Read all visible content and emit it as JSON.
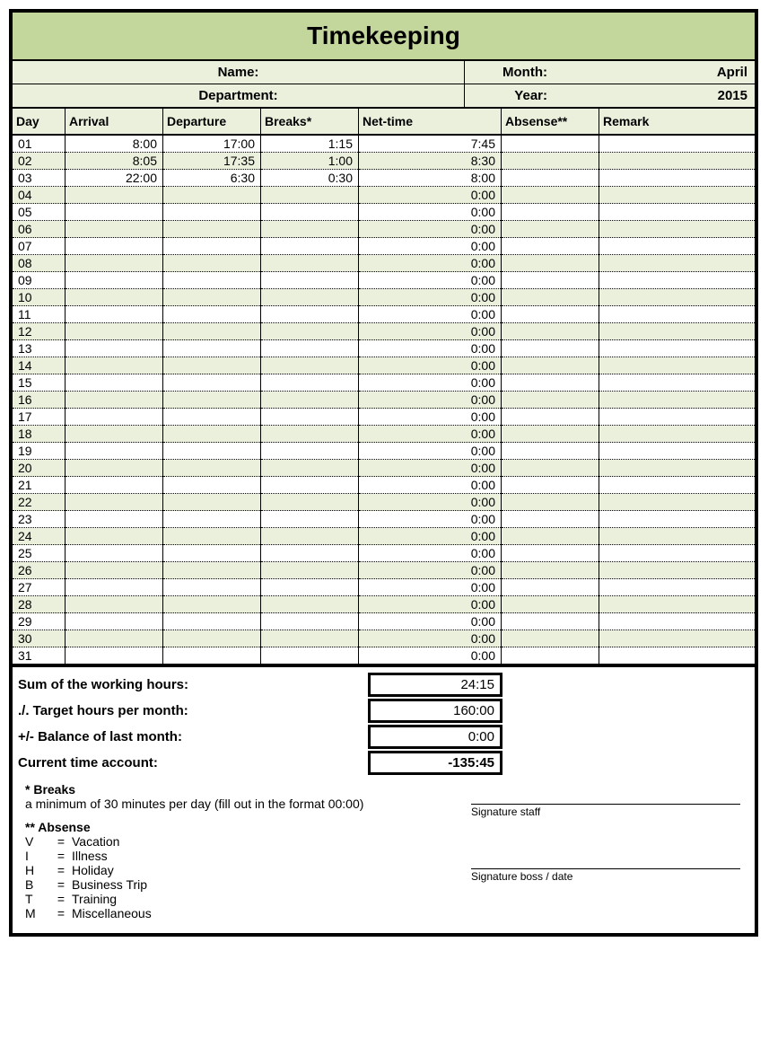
{
  "title": "Timekeeping",
  "labels": {
    "name": "Name:",
    "department": "Department:",
    "month": "Month:",
    "year": "Year:"
  },
  "values": {
    "month": "April",
    "year": "2015"
  },
  "columns": {
    "day": "Day",
    "arrival": "Arrival",
    "departure": "Departure",
    "breaks": "Breaks*",
    "nettime": "Net-time",
    "absense": "Absense**",
    "remark": "Remark"
  },
  "rows": [
    {
      "day": "01",
      "arr": "8:00",
      "dep": "17:00",
      "brk": "1:15",
      "net": "7:45",
      "abs": "",
      "rem": ""
    },
    {
      "day": "02",
      "arr": "8:05",
      "dep": "17:35",
      "brk": "1:00",
      "net": "8:30",
      "abs": "",
      "rem": ""
    },
    {
      "day": "03",
      "arr": "22:00",
      "dep": "6:30",
      "brk": "0:30",
      "net": "8:00",
      "abs": "",
      "rem": ""
    },
    {
      "day": "04",
      "arr": "",
      "dep": "",
      "brk": "",
      "net": "0:00",
      "abs": "",
      "rem": ""
    },
    {
      "day": "05",
      "arr": "",
      "dep": "",
      "brk": "",
      "net": "0:00",
      "abs": "",
      "rem": ""
    },
    {
      "day": "06",
      "arr": "",
      "dep": "",
      "brk": "",
      "net": "0:00",
      "abs": "",
      "rem": ""
    },
    {
      "day": "07",
      "arr": "",
      "dep": "",
      "brk": "",
      "net": "0:00",
      "abs": "",
      "rem": ""
    },
    {
      "day": "08",
      "arr": "",
      "dep": "",
      "brk": "",
      "net": "0:00",
      "abs": "",
      "rem": ""
    },
    {
      "day": "09",
      "arr": "",
      "dep": "",
      "brk": "",
      "net": "0:00",
      "abs": "",
      "rem": ""
    },
    {
      "day": "10",
      "arr": "",
      "dep": "",
      "brk": "",
      "net": "0:00",
      "abs": "",
      "rem": ""
    },
    {
      "day": "11",
      "arr": "",
      "dep": "",
      "brk": "",
      "net": "0:00",
      "abs": "",
      "rem": ""
    },
    {
      "day": "12",
      "arr": "",
      "dep": "",
      "brk": "",
      "net": "0:00",
      "abs": "",
      "rem": ""
    },
    {
      "day": "13",
      "arr": "",
      "dep": "",
      "brk": "",
      "net": "0:00",
      "abs": "",
      "rem": ""
    },
    {
      "day": "14",
      "arr": "",
      "dep": "",
      "brk": "",
      "net": "0:00",
      "abs": "",
      "rem": ""
    },
    {
      "day": "15",
      "arr": "",
      "dep": "",
      "brk": "",
      "net": "0:00",
      "abs": "",
      "rem": ""
    },
    {
      "day": "16",
      "arr": "",
      "dep": "",
      "brk": "",
      "net": "0:00",
      "abs": "",
      "rem": ""
    },
    {
      "day": "17",
      "arr": "",
      "dep": "",
      "brk": "",
      "net": "0:00",
      "abs": "",
      "rem": ""
    },
    {
      "day": "18",
      "arr": "",
      "dep": "",
      "brk": "",
      "net": "0:00",
      "abs": "",
      "rem": ""
    },
    {
      "day": "19",
      "arr": "",
      "dep": "",
      "brk": "",
      "net": "0:00",
      "abs": "",
      "rem": ""
    },
    {
      "day": "20",
      "arr": "",
      "dep": "",
      "brk": "",
      "net": "0:00",
      "abs": "",
      "rem": ""
    },
    {
      "day": "21",
      "arr": "",
      "dep": "",
      "brk": "",
      "net": "0:00",
      "abs": "",
      "rem": ""
    },
    {
      "day": "22",
      "arr": "",
      "dep": "",
      "brk": "",
      "net": "0:00",
      "abs": "",
      "rem": ""
    },
    {
      "day": "23",
      "arr": "",
      "dep": "",
      "brk": "",
      "net": "0:00",
      "abs": "",
      "rem": ""
    },
    {
      "day": "24",
      "arr": "",
      "dep": "",
      "brk": "",
      "net": "0:00",
      "abs": "",
      "rem": ""
    },
    {
      "day": "25",
      "arr": "",
      "dep": "",
      "brk": "",
      "net": "0:00",
      "abs": "",
      "rem": ""
    },
    {
      "day": "26",
      "arr": "",
      "dep": "",
      "brk": "",
      "net": "0:00",
      "abs": "",
      "rem": ""
    },
    {
      "day": "27",
      "arr": "",
      "dep": "",
      "brk": "",
      "net": "0:00",
      "abs": "",
      "rem": ""
    },
    {
      "day": "28",
      "arr": "",
      "dep": "",
      "brk": "",
      "net": "0:00",
      "abs": "",
      "rem": ""
    },
    {
      "day": "29",
      "arr": "",
      "dep": "",
      "brk": "",
      "net": "0:00",
      "abs": "",
      "rem": ""
    },
    {
      "day": "30",
      "arr": "",
      "dep": "",
      "brk": "",
      "net": "0:00",
      "abs": "",
      "rem": ""
    },
    {
      "day": "31",
      "arr": "",
      "dep": "",
      "brk": "",
      "net": "0:00",
      "abs": "",
      "rem": ""
    }
  ],
  "summary": {
    "sum_label": "Sum of the working hours:",
    "sum_value": "24:15",
    "target_label": "./. Target hours per month:",
    "target_value": "160:00",
    "balance_label": "+/- Balance of last month:",
    "balance_value": "0:00",
    "current_label": "Current time account:",
    "current_value": "-135:45"
  },
  "notes": {
    "breaks_head": "* Breaks",
    "breaks_text": "a minimum of 30 minutes per day  (fill out in the format 00:00)",
    "absense_head": "** Absense",
    "legend": [
      {
        "code": "V",
        "eq": "=",
        "desc": "Vacation"
      },
      {
        "code": "I",
        "eq": "=",
        "desc": "Illness"
      },
      {
        "code": "H",
        "eq": "=",
        "desc": "Holiday"
      },
      {
        "code": "B",
        "eq": "=",
        "desc": "Business Trip"
      },
      {
        "code": "T",
        "eq": "=",
        "desc": "Training"
      },
      {
        "code": "M",
        "eq": "=",
        "desc": "Miscellaneous"
      }
    ],
    "sig_staff": "Signature staff",
    "sig_boss": "Signature boss / date"
  }
}
